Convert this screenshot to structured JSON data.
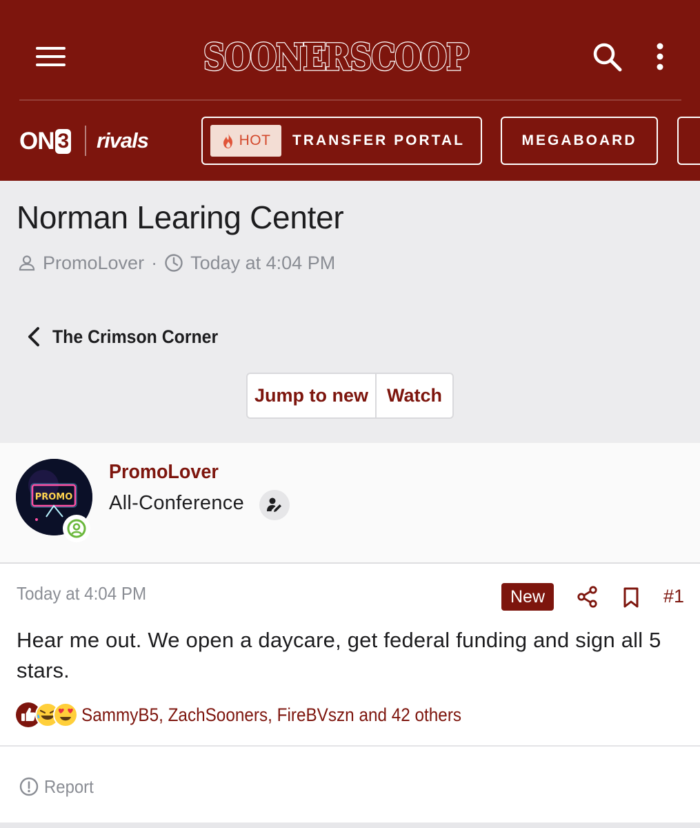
{
  "header": {
    "logo_text": "SOONERSCOOP",
    "brand_on3": "ON3",
    "brand_on3_prefix": "ON",
    "brand_on3_digit": "3",
    "brand_rivals": "rivals",
    "nav": {
      "hot_badge": "HOT",
      "transfer_portal": "TRANSFER PORTAL",
      "megaboard": "MEGABOARD"
    },
    "colors": {
      "brand": "#7d150d",
      "hot_badge_bg": "#f3ddd4",
      "hot_badge_text": "#d3482b"
    },
    "icons": [
      "menu-icon",
      "search-icon",
      "kebab-menu-icon",
      "flame-icon"
    ]
  },
  "thread": {
    "title": "Norman Learing Center",
    "author": "PromoLover",
    "separator": "·",
    "time": "Today at 4:04 PM",
    "back_label": "The Crimson Corner",
    "actions": {
      "jump_to_new": "Jump to new",
      "watch": "Watch"
    }
  },
  "user": {
    "name": "PromoLover",
    "title": "All-Conference",
    "avatar_text": "PROMO",
    "status": "online"
  },
  "post": {
    "date": "Today at 4:04 PM",
    "new_badge": "New",
    "number": "#1",
    "body": "Hear me out. We open a daycare, get federal funding and sign all 5 stars.",
    "reactions_text": "SammyB5, ZachSooners, FireBVszn and 42 others",
    "reaction_icons": [
      "thumbs-up-icon",
      "laughing-emoji-icon",
      "heart-eyes-emoji-icon"
    ],
    "report_label": "Report"
  }
}
